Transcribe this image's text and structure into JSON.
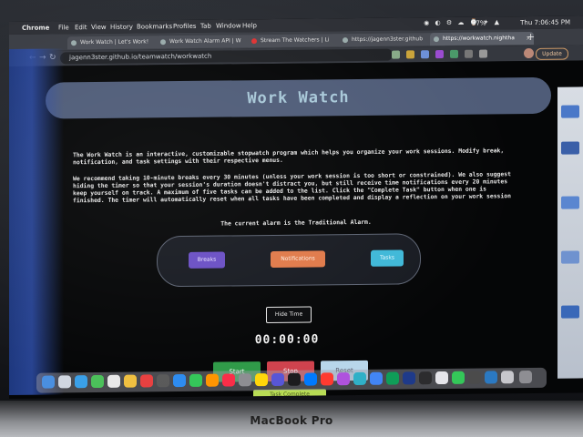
{
  "menubar": {
    "app": "Chrome",
    "items": [
      "File",
      "Edit",
      "View",
      "History",
      "Bookmarks",
      "Profiles",
      "Tab",
      "Window",
      "Help"
    ],
    "battery": "97%",
    "clock": "Thu 7:06:45 PM"
  },
  "tabs": [
    {
      "label": "Work Watch | Let's Work!"
    },
    {
      "label": "Work Watch Alarm API | W"
    },
    {
      "label": "Stream The Watchers | Li"
    },
    {
      "label": "https://jagenn3ster.github"
    },
    {
      "label": "https://workwatch.nightha"
    }
  ],
  "address": {
    "url": "jagenn3ster.github.io/teamwatch/workwatch"
  },
  "toolbar": {
    "update_label": "Update"
  },
  "page": {
    "title": "Work Watch",
    "intro": "The Work Watch is an interactive, customizable stopwatch program which helps you organize your work sessions. Modify break, notification, and task settings with their respective menus.",
    "recommendation": "We recommend taking 10-minute breaks every 30 minutes (unless your work session is too short or constrained). We also suggest hiding the timer so that your session's duration doesn't distract you, but still receive time notifications every 20 minutes keep yourself on track. A maximum of five tasks can be added to the list. Click the \"Complete Task\" button when one is finished. The timer will automatically reset when all tasks have been completed and display a reflection on your work session",
    "alarm_line": "The current alarm is the Traditional Alarm.",
    "settings": {
      "breaks": "Breaks",
      "notifications": "Notifications",
      "tasks": "Tasks"
    },
    "hide_time": "Hide Time",
    "timer": "00:00:00",
    "controls": {
      "start": "Start",
      "stop": "Stop",
      "reset": "Reset"
    },
    "complete_task": "Task Complete"
  },
  "laptop": {
    "brand": "MacBook Pro"
  },
  "colors": {
    "title_bar": "#4f5c78",
    "breaks": "#6a4fc4",
    "notifications": "#e07a4a",
    "tasks": "#3fb8d8",
    "start": "#2f9a48",
    "stop": "#d0424d",
    "reset": "#b8d6ea",
    "complete": "#b8dc55"
  }
}
